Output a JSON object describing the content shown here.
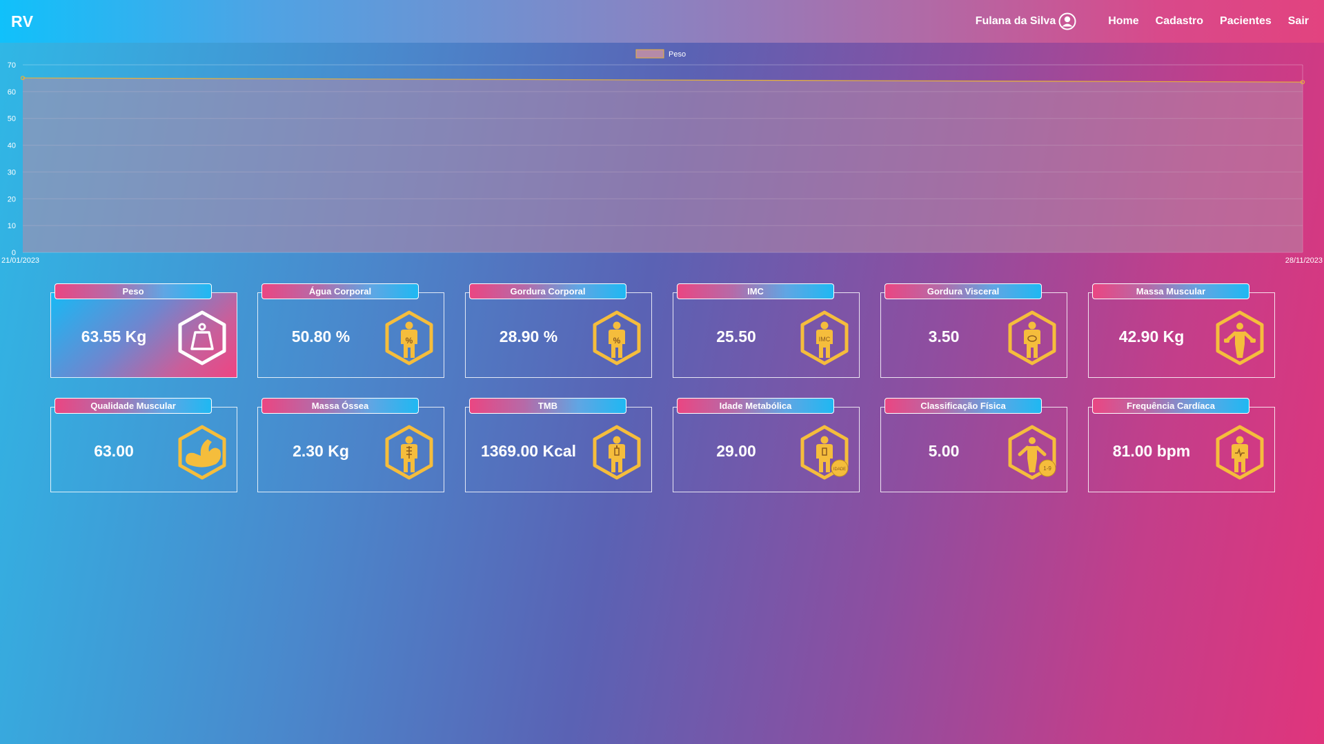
{
  "navbar": {
    "brand": "RV",
    "user_name": "Fulana da Silva",
    "links": [
      "Home",
      "Cadastro",
      "Pacientes",
      "Sair"
    ]
  },
  "chart_data": {
    "type": "area",
    "legend": [
      "Peso"
    ],
    "legend_position": "top-center",
    "x": [
      "21/01/2023",
      "28/11/2023"
    ],
    "series": [
      {
        "name": "Peso",
        "values": [
          65.1,
          63.55
        ]
      }
    ],
    "yticks": [
      0,
      10,
      20,
      30,
      40,
      50,
      60,
      70
    ],
    "ylim": [
      0,
      70
    ],
    "grid": true,
    "colors": {
      "line": "#e8b23a",
      "fill": "#b58aa8"
    }
  },
  "cards": [
    {
      "label": "Peso",
      "value": "63.55 Kg",
      "icon": "weight-icon",
      "highlight": true
    },
    {
      "label": "Água Corporal",
      "value": "50.80 %",
      "icon": "body-water-icon"
    },
    {
      "label": "Gordura Corporal",
      "value": "28.90 %",
      "icon": "body-fat-icon"
    },
    {
      "label": "IMC",
      "value": "25.50",
      "icon": "bmi-icon",
      "icon_text": "IMC"
    },
    {
      "label": "Gordura Visceral",
      "value": "3.50",
      "icon": "visceral-fat-icon"
    },
    {
      "label": "Massa Muscular",
      "value": "42.90 Kg",
      "icon": "muscle-mass-icon"
    },
    {
      "label": "Qualidade Muscular",
      "value": "63.00",
      "icon": "muscle-quality-icon"
    },
    {
      "label": "Massa Óssea",
      "value": "2.30 Kg",
      "icon": "bone-mass-icon"
    },
    {
      "label": "TMB",
      "value": "1369.00 Kcal",
      "icon": "bmr-icon"
    },
    {
      "label": "Idade Metabólica",
      "value": "29.00",
      "icon": "metabolic-age-icon",
      "icon_text": "IDADE"
    },
    {
      "label": "Classificação Física",
      "value": "5.00",
      "icon": "physique-rating-icon",
      "icon_text": "1-9"
    },
    {
      "label": "Frequência Cardíaca",
      "value": "81.00 bpm",
      "icon": "heart-rate-icon"
    }
  ],
  "colors": {
    "accent": "#f5bd3c",
    "border": "#ffffff"
  }
}
